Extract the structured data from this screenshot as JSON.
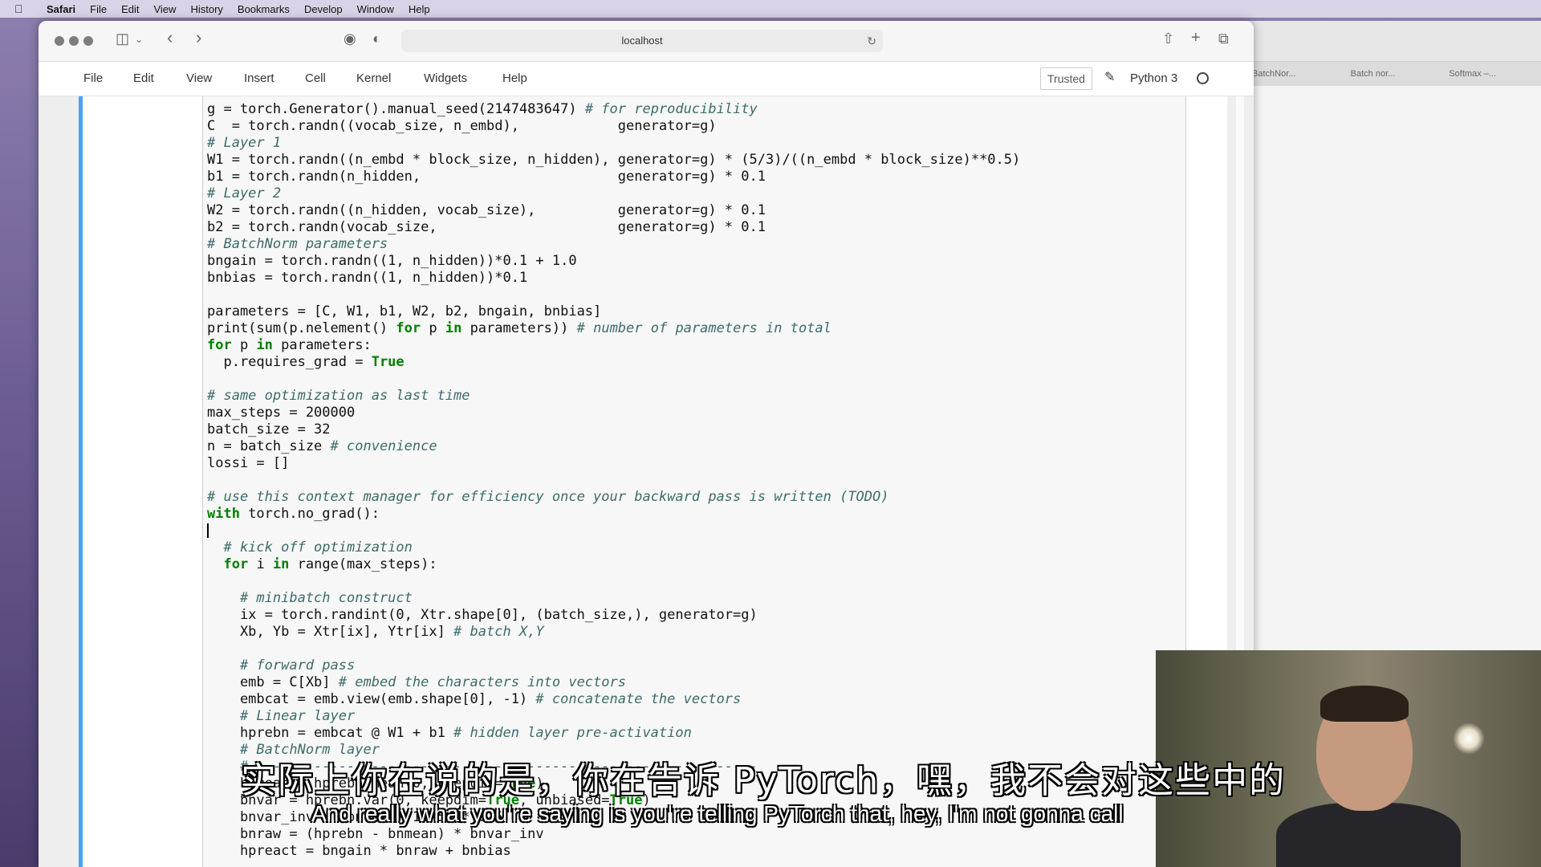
{
  "menubar": {
    "app": "Safari",
    "items": [
      "File",
      "Edit",
      "View",
      "History",
      "Bookmarks",
      "Develop",
      "Window",
      "Help"
    ]
  },
  "browser": {
    "url": "localhost",
    "bg_tabs": [
      "BatchNor...",
      "Batch nor...",
      "Softmax –..."
    ]
  },
  "jupyter": {
    "menu": [
      "File",
      "Edit",
      "View",
      "Insert",
      "Cell",
      "Kernel",
      "Widgets",
      "Help"
    ],
    "trusted": "Trusted",
    "kernel": "Python 3"
  },
  "code": [
    {
      "t": "g = torch.Generator().manual_seed(2147483647) "
    },
    {
      "t": "C  = torch.randn((vocab_size, n_embd),            generator=g)"
    },
    {
      "t": "# Layer 1",
      "c": true
    },
    {
      "t": "W1 = torch.randn((n_embd * block_size, n_hidden), generator=g) * (5/3)/((n_embd * block_size)**0.5)"
    },
    {
      "t": "b1 = torch.randn(n_hidden,                        generator=g) * 0.1"
    },
    {
      "t": "# Layer 2",
      "c": true
    },
    {
      "t": "W2 = torch.randn((n_hidden, vocab_size),          generator=g) * 0.1"
    },
    {
      "t": "b2 = torch.randn(vocab_size,                      generator=g) * 0.1"
    },
    {
      "t": "# BatchNorm parameters",
      "c": true
    },
    {
      "t": "bngain = torch.randn((1, n_hidden))*0.1 + 1.0"
    },
    {
      "t": "bnbias = torch.randn((1, n_hidden))*0.1"
    },
    {
      "t": ""
    },
    {
      "t": "parameters = [C, W1, b1, W2, b2, bngain, bnbias]"
    },
    {
      "t": "print(sum(p.nelement() for p in parameters)) "
    },
    {
      "t": "for p in parameters:"
    },
    {
      "t": "  p.requires_grad = True"
    },
    {
      "t": ""
    },
    {
      "t": "# same optimization as last time",
      "c": true
    },
    {
      "t": "max_steps = 200000"
    },
    {
      "t": "batch_size = 32"
    },
    {
      "t": "n = batch_size "
    },
    {
      "t": "lossi = []"
    },
    {
      "t": ""
    },
    {
      "t": "# use this context manager for efficiency once your backward pass is written (TODO)",
      "c": true
    },
    {
      "t": "with torch.no_grad():"
    },
    {
      "t": ""
    },
    {
      "t": "  # kick off optimization",
      "c": true
    },
    {
      "t": "  for i in range(max_steps):"
    },
    {
      "t": ""
    },
    {
      "t": "    # minibatch construct",
      "c": true
    },
    {
      "t": "    ix = torch.randint(0, Xtr.shape[0], (batch_size,), generator=g)"
    },
    {
      "t": "    Xb, Yb = Xtr[ix], Ytr[ix] "
    },
    {
      "t": ""
    },
    {
      "t": "    # forward pass",
      "c": true
    },
    {
      "t": "    emb = C[Xb] "
    },
    {
      "t": "    embcat = emb.view(emb.shape[0], -1) "
    },
    {
      "t": "    # Linear layer",
      "c": true
    },
    {
      "t": "    hprebn = embcat @ W1 + b1 "
    },
    {
      "t": "    # BatchNorm layer",
      "c": true
    },
    {
      "t": "    # -------------------------------------------------------------",
      "c": true
    },
    {
      "t": "    bnmean = hprebn.mean(0, keepdim=True)"
    },
    {
      "t": "    bnvar = hprebn.var(0, keepdim=True, unbiased=True)"
    },
    {
      "t": "    bnvar_inv = (bnvar + 1e-5)**-0.5"
    },
    {
      "t": "    bnraw = (hprebn - bnmean) * bnvar_inv"
    },
    {
      "t": "    hpreact = bngain * bnraw + bnbias"
    }
  ],
  "comments_inline": {
    "l0": "# for reproducibility",
    "l13": "# number of parameters in total",
    "l20": "# convenience",
    "l31": "# batch X,Y",
    "l34": "# embed the characters into vectors",
    "l35": "# concatenate the vectors",
    "l37": "# hidden layer pre-activation"
  },
  "subtitles": {
    "zh": "实际上你在说的是，你在告诉 PyTorch，嘿，我不会对这些中的",
    "en": "And really what you're saying is you're telling PyTorch that, hey, I'm not gonna call"
  }
}
